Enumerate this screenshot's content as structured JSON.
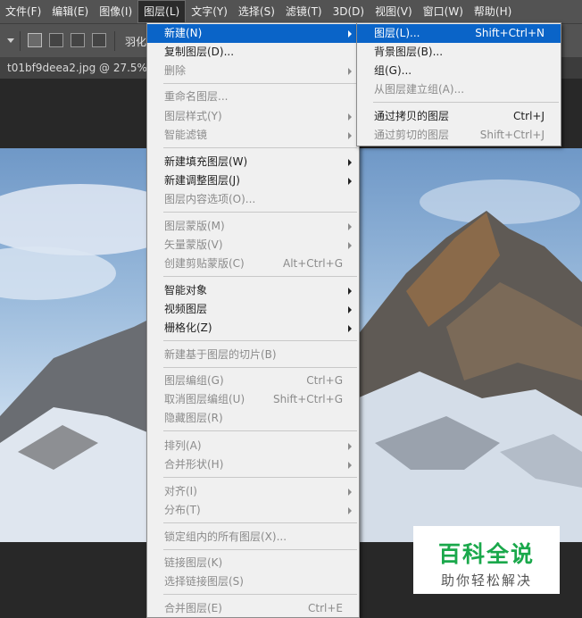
{
  "menubar": {
    "items": [
      "文件(F)",
      "编辑(E)",
      "图像(I)",
      "图层(L)",
      "文字(Y)",
      "选择(S)",
      "滤镜(T)",
      "3D(D)",
      "视图(V)",
      "窗口(W)",
      "帮助(H)"
    ]
  },
  "options": {
    "feather_label": "羽化"
  },
  "document": {
    "tab_label": "t01bf9deea2.jpg @ 27.5%(R"
  },
  "layer_menu": {
    "new": {
      "label": "新建(N)"
    },
    "duplicate": {
      "label": "复制图层(D)..."
    },
    "delete": {
      "label": "删除"
    },
    "rename": {
      "label": "重命名图层..."
    },
    "layer_style": {
      "label": "图层样式(Y)"
    },
    "smart_filter": {
      "label": "智能滤镜"
    },
    "new_fill": {
      "label": "新建填充图层(W)"
    },
    "new_adjust": {
      "label": "新建调整图层(J)"
    },
    "content_options": {
      "label": "图层内容选项(O)..."
    },
    "layer_mask": {
      "label": "图层蒙版(M)"
    },
    "vector_mask": {
      "label": "矢量蒙版(V)"
    },
    "clipping_mask": {
      "label": "创建剪贴蒙版(C)",
      "shortcut": "Alt+Ctrl+G"
    },
    "smart_object": {
      "label": "智能对象"
    },
    "video_layers": {
      "label": "视频图层"
    },
    "rasterize": {
      "label": "栅格化(Z)"
    },
    "slice": {
      "label": "新建基于图层的切片(B)"
    },
    "group": {
      "label": "图层编组(G)",
      "shortcut": "Ctrl+G"
    },
    "ungroup": {
      "label": "取消图层编组(U)",
      "shortcut": "Shift+Ctrl+G"
    },
    "hide": {
      "label": "隐藏图层(R)"
    },
    "arrange": {
      "label": "排列(A)"
    },
    "combine": {
      "label": "合并形状(H)"
    },
    "align": {
      "label": "对齐(I)"
    },
    "distribute": {
      "label": "分布(T)"
    },
    "lock_all": {
      "label": "锁定组内的所有图层(X)..."
    },
    "link": {
      "label": "链接图层(K)"
    },
    "select_linked": {
      "label": "选择链接图层(S)"
    },
    "merge": {
      "label": "合并图层(E)",
      "shortcut": "Ctrl+E"
    }
  },
  "new_submenu": {
    "layer": {
      "label": "图层(L)...",
      "shortcut": "Shift+Ctrl+N"
    },
    "background": {
      "label": "背景图层(B)..."
    },
    "group": {
      "label": "组(G)..."
    },
    "group_from_layers": {
      "label": "从图层建立组(A)..."
    },
    "via_copy": {
      "label": "通过拷贝的图层",
      "shortcut": "Ctrl+J"
    },
    "via_cut": {
      "label": "通过剪切的图层",
      "shortcut": "Shift+Ctrl+J"
    }
  },
  "watermark": {
    "title": "百科全说",
    "subtitle": "助你轻松解决"
  },
  "colors": {
    "highlight": "#0a64c8",
    "menubar": "#535353",
    "watermark_green": "#1aa84b"
  }
}
